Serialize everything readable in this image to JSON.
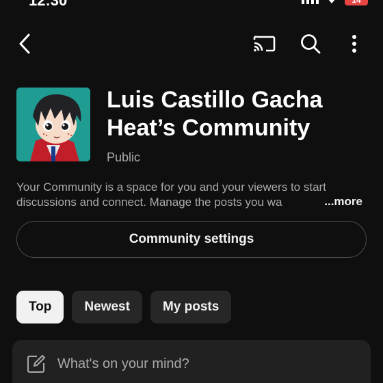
{
  "status_bar": {
    "time": "12:30",
    "battery": "14"
  },
  "top_bar": {
    "back_icon": "chevron-left-icon",
    "cast_icon": "cast-icon",
    "search_icon": "search-icon",
    "more_icon": "more-vert-icon"
  },
  "community": {
    "title": "Luis Castillo Gacha Heat’s Community",
    "visibility": "Public",
    "description": "Your Community is a space for you and your viewers to start discussions and connect. Manage the posts you wa",
    "more_label": "...more"
  },
  "actions": {
    "settings_label": "Community settings"
  },
  "filters": {
    "tabs": [
      {
        "label": "Top",
        "active": true
      },
      {
        "label": "Newest",
        "active": false
      },
      {
        "label": "My posts",
        "active": false
      }
    ]
  },
  "composer": {
    "placeholder": "What's on your mind?",
    "icon": "edit-icon"
  },
  "colors": {
    "background": "#0f0f0f",
    "chip": "#272727",
    "chip_active": "#f1f1f1",
    "battery": "#e84545"
  }
}
